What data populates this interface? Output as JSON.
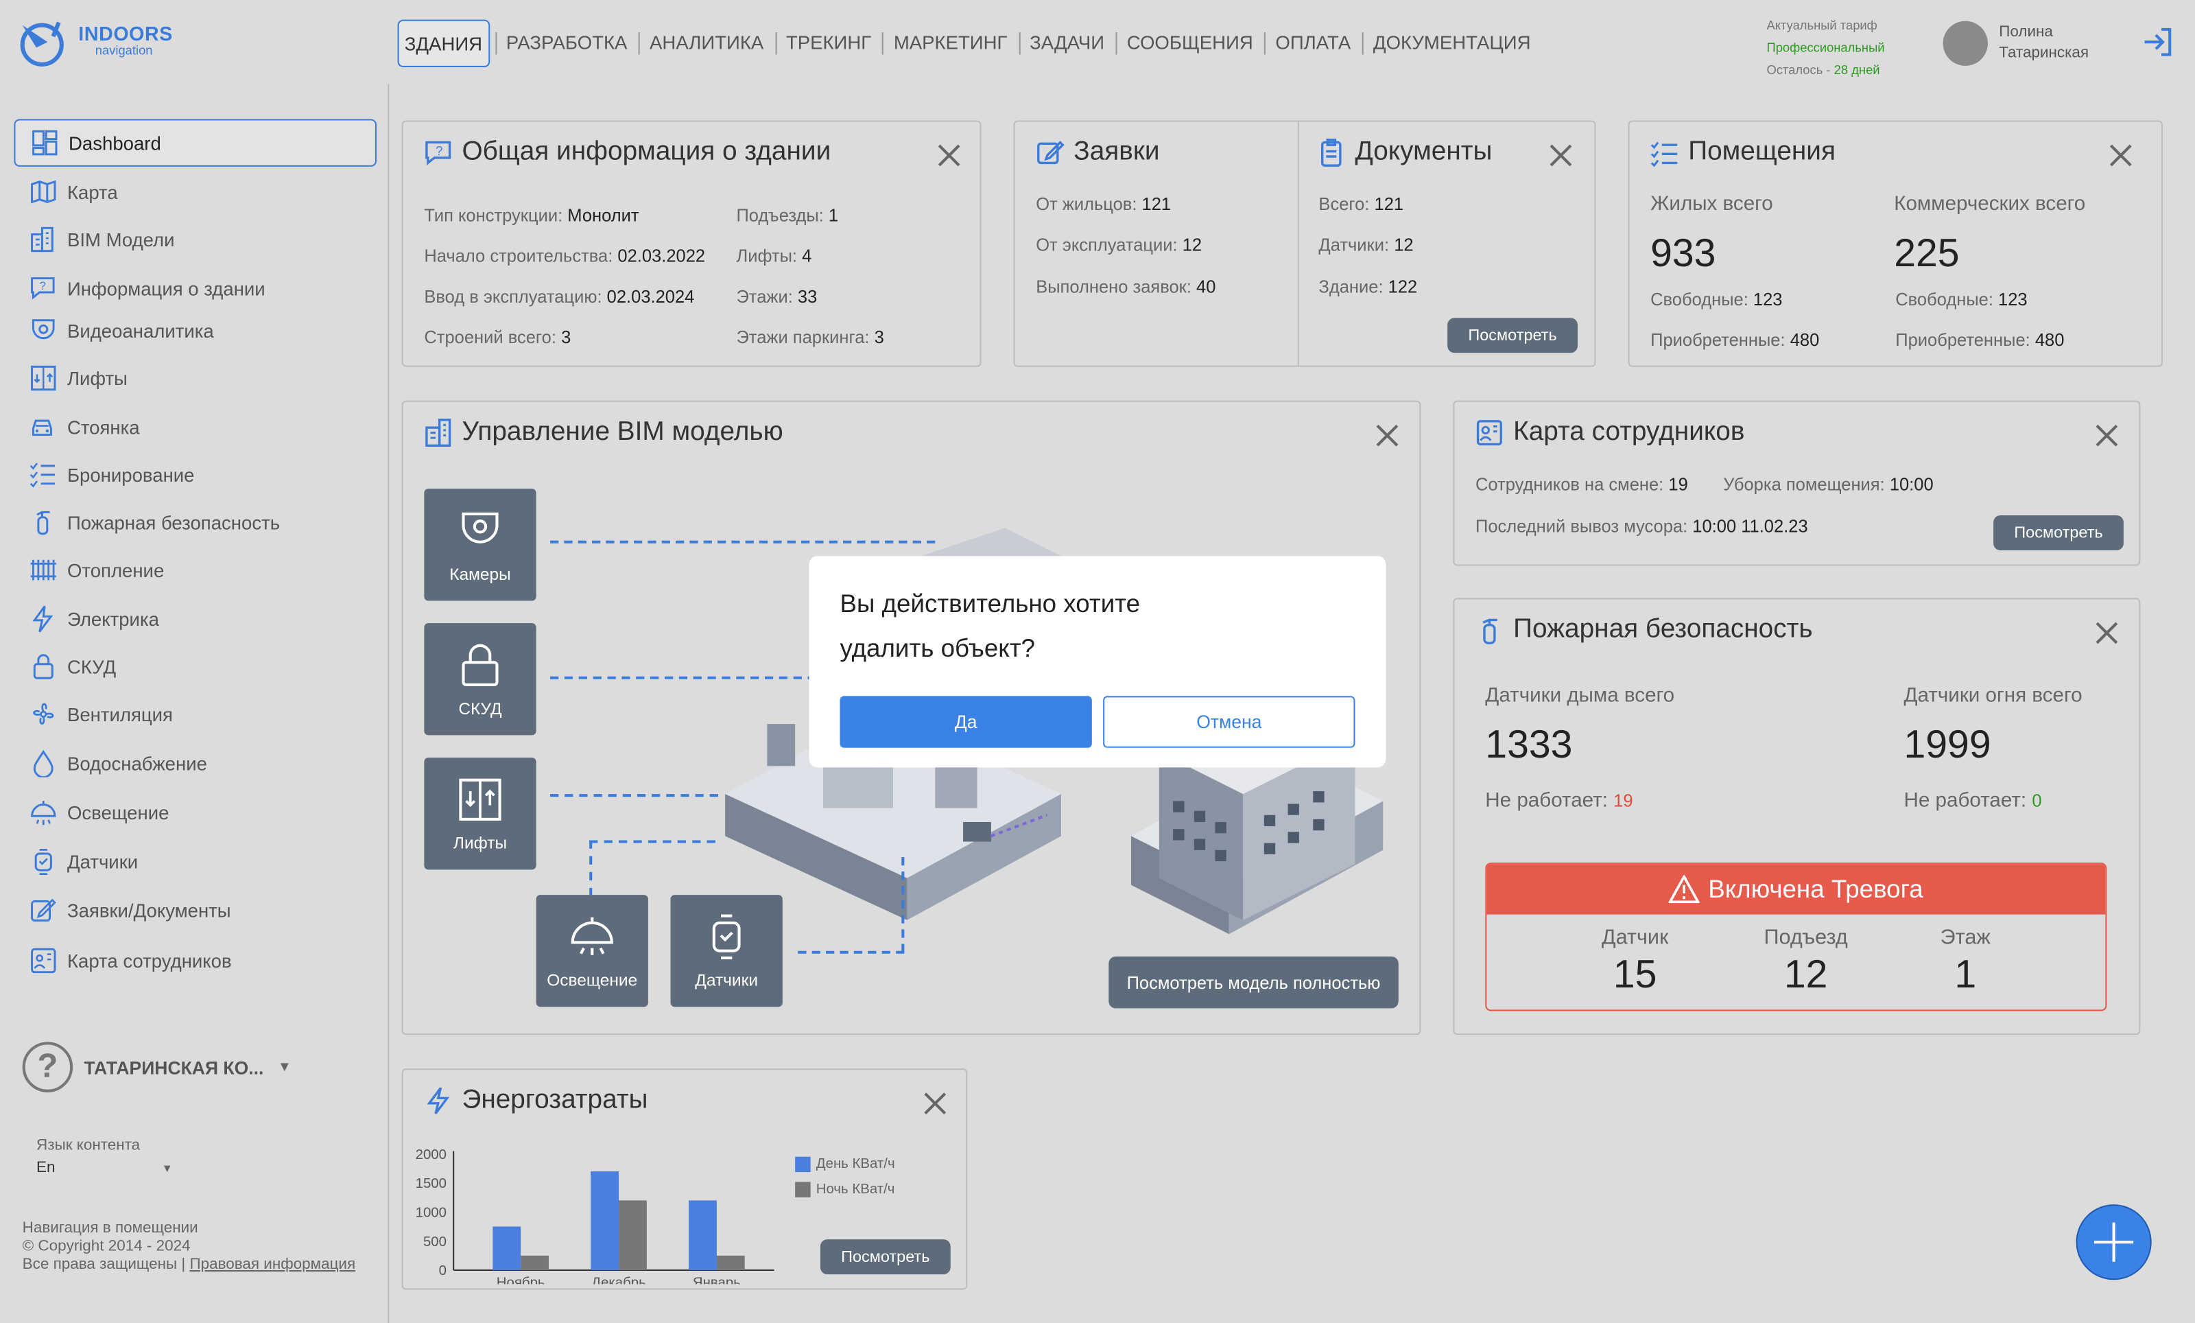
{
  "logo": {
    "name": "INDOORS",
    "sub": "navigation"
  },
  "nav": [
    {
      "label": "ЗДАНИЯ",
      "active": true
    },
    {
      "label": "РАЗРАБОТКА"
    },
    {
      "label": "АНАЛИТИКА"
    },
    {
      "label": "ТРЕКИНГ"
    },
    {
      "label": "МАРКЕТИНГ"
    },
    {
      "label": "ЗАДАЧИ"
    },
    {
      "label": "СООБЩЕНИЯ"
    },
    {
      "label": "ОПЛАТА"
    },
    {
      "label": "ДОКУМЕНТАЦИЯ"
    }
  ],
  "tariff": {
    "label": "Актуальный тариф",
    "value": "Профессиональный",
    "left_label": "Осталось",
    "left_sep": "-",
    "left_value": "28 дней"
  },
  "user": {
    "first": "Полина",
    "last": "Татаринская"
  },
  "sidebar": {
    "items": [
      {
        "label": "Dashboard",
        "icon": "dashboard-icon"
      },
      {
        "label": "Карта",
        "icon": "map-icon"
      },
      {
        "label": "BIM Модели",
        "icon": "building-icon"
      },
      {
        "label": "Информация о здании",
        "icon": "info-chat-icon"
      },
      {
        "label": "Видеоаналитика",
        "icon": "camera-icon"
      },
      {
        "label": "Лифты",
        "icon": "elevator-icon"
      },
      {
        "label": "Стоянка",
        "icon": "car-icon"
      },
      {
        "label": "Бронирование",
        "icon": "list-check-icon"
      },
      {
        "label": "Пожарная безопасность",
        "icon": "extinguisher-icon"
      },
      {
        "label": "Отопление",
        "icon": "radiator-icon"
      },
      {
        "label": "Электрика",
        "icon": "lightning-icon"
      },
      {
        "label": "СКУД",
        "icon": "lock-icon"
      },
      {
        "label": "Вентиляция",
        "icon": "fan-icon"
      },
      {
        "label": "Водоснабжение",
        "icon": "drop-icon"
      },
      {
        "label": "Освещение",
        "icon": "lamp-icon"
      },
      {
        "label": "Датчики",
        "icon": "sensor-icon"
      },
      {
        "label": "Заявки/Документы",
        "icon": "edit-icon"
      },
      {
        "label": "Карта сотрудников",
        "icon": "staff-map-icon"
      }
    ],
    "company": "ТАТАРИНСКАЯ КО...",
    "lang_label": "Язык контента",
    "lang_value": "En",
    "footer_line1": "Навигация в помещении",
    "footer_line2": "© Copyright 2014 - 2024",
    "footer_line3": "Все права защищены |",
    "footer_link": "Правовая информация"
  },
  "building_info": {
    "title": "Общая информация о здании",
    "rows": [
      {
        "k": "Тип конструкции:",
        "v": "Монолит"
      },
      {
        "k": "Начало строительства:",
        "v": "02.03.2022"
      },
      {
        "k": "Ввод в эксплуатацию:",
        "v": "02.03.2024"
      },
      {
        "k": "Строений всего:",
        "v": "3"
      },
      {
        "k": "Подъезды:",
        "v": "1"
      },
      {
        "k": "Лифты:",
        "v": "4"
      },
      {
        "k": "Этажи:",
        "v": "33"
      },
      {
        "k": "Этажи паркинга:",
        "v": "3"
      }
    ]
  },
  "requests": {
    "title": "Заявки",
    "rows": [
      {
        "k": "От жильцов:",
        "v": "121"
      },
      {
        "k": "От эксплуатации:",
        "v": "12"
      },
      {
        "k": "Выполнено заявок:",
        "v": "40"
      }
    ]
  },
  "documents": {
    "title": "Документы",
    "rows": [
      {
        "k": "Всего:",
        "v": "121"
      },
      {
        "k": "Датчики:",
        "v": "12"
      },
      {
        "k": "Здание:",
        "v": "122"
      }
    ],
    "button": "Посмотреть"
  },
  "rooms": {
    "title": "Помещения",
    "residential_label": "Жилых всего",
    "residential_value": "933",
    "commercial_label": "Коммерческих всего",
    "commercial_value": "225",
    "free_label": "Свободные:",
    "res_free": "123",
    "com_free": "123",
    "bought_label": "Приобретенные:",
    "res_bought": "480",
    "com_bought": "480"
  },
  "bim": {
    "title": "Управление BIM моделью",
    "boxes": [
      "Камеры",
      "СКУД",
      "Лифты",
      "Освещение",
      "Датчики"
    ],
    "button": "Посмотреть модель полностью"
  },
  "staff_map": {
    "title": "Карта сотрудников",
    "shift_label": "Сотрудников на смене:",
    "shift_value": "19",
    "clean_label": "Уборка помещения:",
    "clean_value": "10:00",
    "trash_label": "Последний вывоз мусора:",
    "trash_value": "10:00 11.02.23",
    "button": "Посмотреть"
  },
  "fire": {
    "title": "Пожарная безопасность",
    "smoke_label": "Датчики дыма всего",
    "smoke_value": "1333",
    "fire_label": "Датчики огня всего",
    "fire_value": "1999",
    "broken_label": "Не работает:",
    "smoke_broken": "19",
    "fire_broken": "0",
    "alarm_title": "Включена Тревога",
    "alarm_cols": [
      {
        "label": "Датчик",
        "value": "15"
      },
      {
        "label": "Подъезд",
        "value": "12"
      },
      {
        "label": "Этаж",
        "value": "1"
      }
    ]
  },
  "energy": {
    "title": "Энергозатраты",
    "button": "Посмотреть"
  },
  "chart_data": {
    "type": "bar",
    "categories": [
      "Ноябрь",
      "Декабрь",
      "Январь"
    ],
    "series": [
      {
        "name": "День КВат/ч",
        "values": [
          750,
          1700,
          1200
        ],
        "color": "#4a7fe0"
      },
      {
        "name": "Ночь КВат/ч",
        "values": [
          250,
          1200,
          250
        ],
        "color": "#777777"
      }
    ],
    "yticks": [
      "2000",
      "1500",
      "1000",
      "500",
      "0"
    ],
    "ylim": [
      0,
      2000
    ]
  },
  "dialog": {
    "message_line1": "Вы действительно хотите",
    "message_line2": "удалить объект?",
    "yes": "Да",
    "no": "Отмена"
  }
}
